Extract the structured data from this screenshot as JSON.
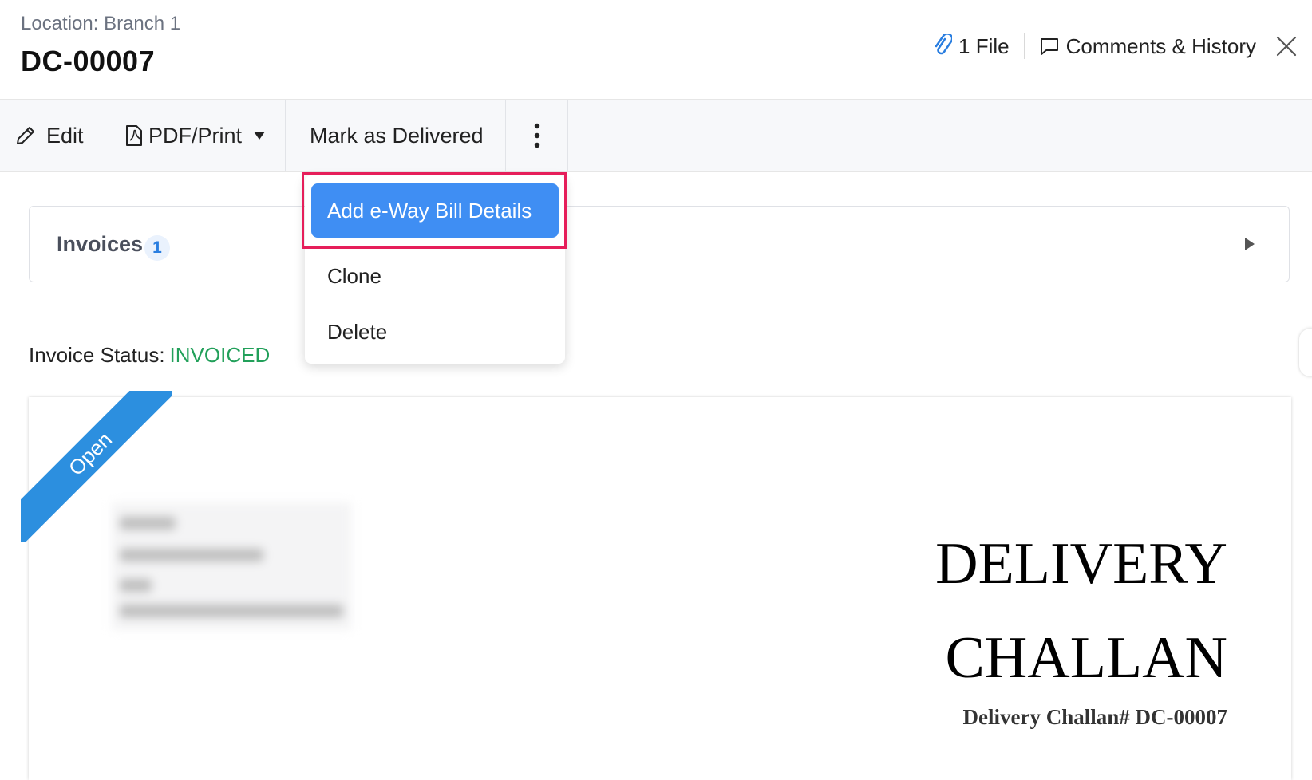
{
  "header": {
    "location": "Location: Branch 1",
    "title": "DC-00007",
    "files_label": "1 File",
    "comments_label": "Comments & History"
  },
  "toolbar": {
    "edit_label": "Edit",
    "pdf_label": "PDF/Print",
    "mark_delivered_label": "Mark as Delivered"
  },
  "dropdown": {
    "items": [
      {
        "label": "Add e-Way Bill Details"
      },
      {
        "label": "Clone"
      },
      {
        "label": "Delete"
      }
    ]
  },
  "invoices": {
    "label": "Invoices",
    "count": "1"
  },
  "invoice_status": {
    "label": "Invoice Status:",
    "value": "INVOICED"
  },
  "document": {
    "ribbon_text": "Open",
    "title_line1": "DELIVERY",
    "title_line2": "CHALLAN",
    "number_line": "Delivery Challan# DC-00007"
  },
  "colors": {
    "accent": "#3f8ef3",
    "ribbon": "#2c8fdf",
    "status_green": "#22a05a",
    "highlight": "#e61e5a"
  }
}
